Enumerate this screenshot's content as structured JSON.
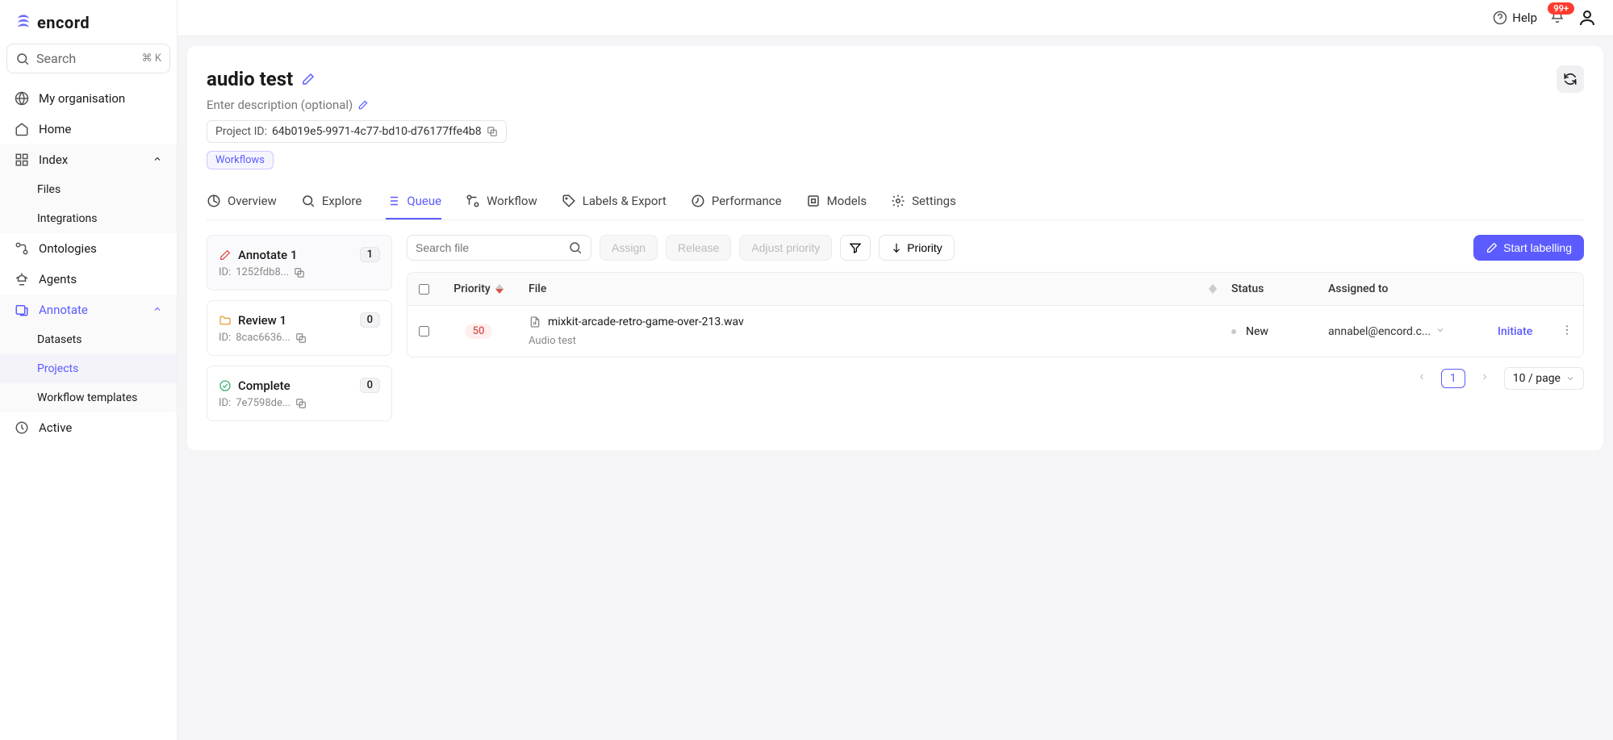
{
  "brand": "encord",
  "search": {
    "placeholder": "Search",
    "shortcut": "⌘ K"
  },
  "sidebar": {
    "org": "My organisation",
    "home": "Home",
    "index": {
      "label": "Index",
      "files": "Files",
      "integrations": "Integrations"
    },
    "ontologies": "Ontologies",
    "agents": "Agents",
    "annotate": {
      "label": "Annotate",
      "datasets": "Datasets",
      "projects": "Projects",
      "templates": "Workflow templates"
    },
    "active": "Active"
  },
  "topbar": {
    "help": "Help",
    "notifications": "99+"
  },
  "project": {
    "title": "audio test",
    "description_placeholder": "Enter description (optional)",
    "id_label": "Project ID:",
    "id": "64b019e5-9971-4c77-bd10-d76177ffe4b8",
    "badge": "Workflows"
  },
  "tabs": [
    "Overview",
    "Explore",
    "Queue",
    "Workflow",
    "Labels & Export",
    "Performance",
    "Models",
    "Settings"
  ],
  "active_tab": "Queue",
  "stages": [
    {
      "label": "Annotate 1",
      "id_prefix": "ID:",
      "id": "1252fdb8...",
      "count": "1",
      "kind": "annotate"
    },
    {
      "label": "Review 1",
      "id_prefix": "ID:",
      "id": "8cac6636...",
      "count": "0",
      "kind": "review"
    },
    {
      "label": "Complete",
      "id_prefix": "ID:",
      "id": "7e7598de...",
      "count": "0",
      "kind": "complete"
    }
  ],
  "toolbar": {
    "search_placeholder": "Search file",
    "assign": "Assign",
    "release": "Release",
    "adjust": "Adjust priority",
    "priority": "Priority",
    "start": "Start labelling"
  },
  "table": {
    "headers": {
      "priority": "Priority",
      "file": "File",
      "status": "Status",
      "assigned": "Assigned to"
    },
    "rows": [
      {
        "priority": "50",
        "file": "mixkit-arcade-retro-game-over-213.wav",
        "folder": "Audio test",
        "status": "New",
        "assignee": "annabel@encord.c...",
        "action": "Initiate"
      }
    ]
  },
  "pager": {
    "page": "1",
    "size": "10 / page"
  }
}
